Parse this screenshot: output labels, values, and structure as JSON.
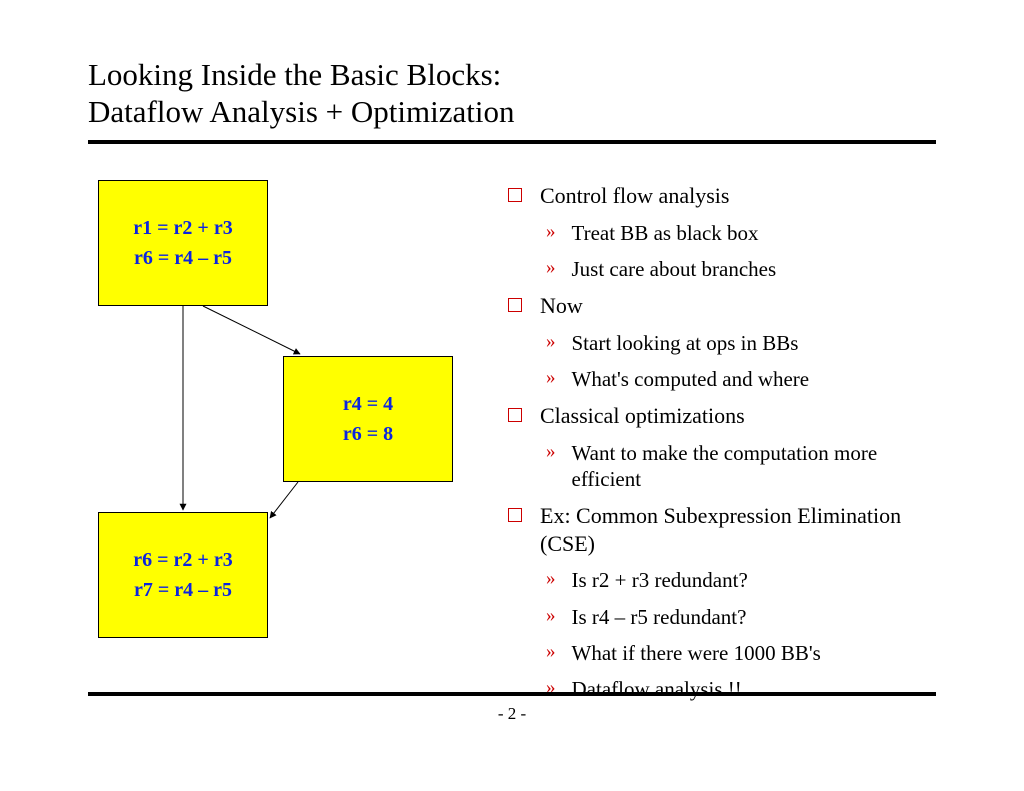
{
  "title_line1": "Looking Inside the Basic Blocks:",
  "title_line2": "Dataflow Analysis + Optimization",
  "page_number": "- 2 -",
  "blocks": {
    "bb1": {
      "line1": "r1 = r2 + r3",
      "line2": "r6 = r4 – r5"
    },
    "bb2": {
      "line1": "r4 = 4",
      "line2": "r6 = 8"
    },
    "bb3": {
      "line1": "r6 = r2 + r3",
      "line2": "r7 = r4 – r5"
    }
  },
  "bullets": [
    {
      "level": 1,
      "text": "Control flow analysis"
    },
    {
      "level": 2,
      "text": "Treat BB as black box"
    },
    {
      "level": 2,
      "text": "Just care about branches"
    },
    {
      "level": 1,
      "text": "Now"
    },
    {
      "level": 2,
      "text": "Start looking at ops in BBs"
    },
    {
      "level": 2,
      "text": "What's computed and where"
    },
    {
      "level": 1,
      "text": "Classical optimizations"
    },
    {
      "level": 2,
      "text": "Want to make the computation more efficient"
    },
    {
      "level": 1,
      "text": "Ex: Common Subexpression Elimination (CSE)"
    },
    {
      "level": 2,
      "text": "Is r2 + r3 redundant?"
    },
    {
      "level": 2,
      "text": "Is r4 – r5 redundant?"
    },
    {
      "level": 2,
      "text": "What if there were 1000 BB's"
    },
    {
      "level": 2,
      "text": "Dataflow analysis !!"
    }
  ]
}
